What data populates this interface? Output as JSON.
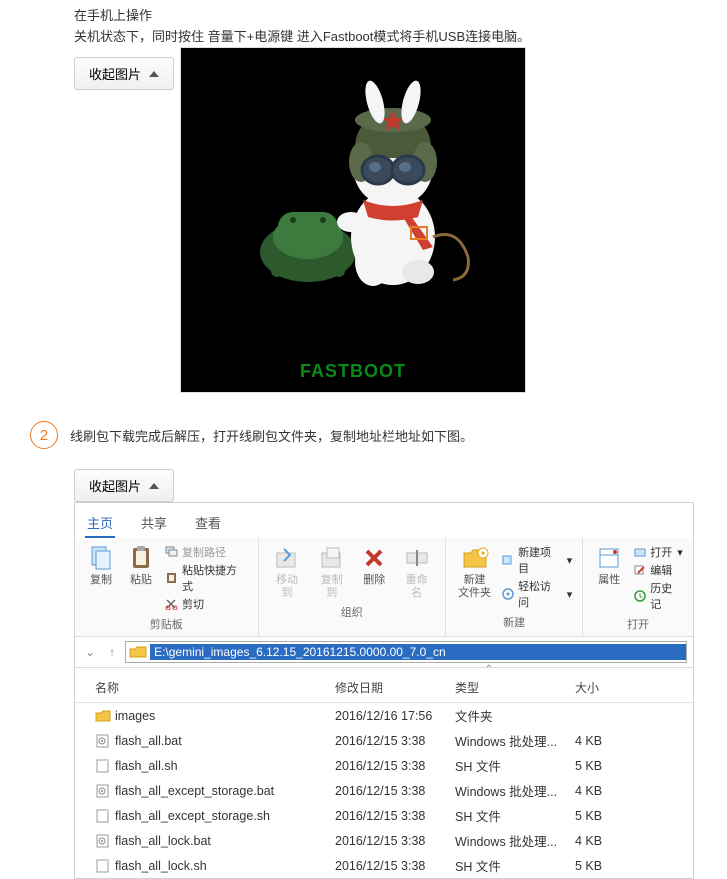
{
  "intro": {
    "line1": "在手机上操作",
    "line2": "关机状态下，同时按住 音量下+电源键 进入Fastboot模式将手机USB连接电脑。"
  },
  "collapse1": "收起图片",
  "fastboot_label": "FASTBOOT",
  "step_num": "2",
  "step_text": "线刷包下载完成后解压，打开线刷包文件夹，复制地址栏地址如下图。",
  "collapse2": "收起图片",
  "explorer": {
    "tabs": {
      "home": "主页",
      "share": "共享",
      "view": "查看"
    },
    "ribbon": {
      "copy": "复制",
      "paste": "粘贴",
      "copy_path": "复制路径",
      "paste_shortcut": "粘贴快捷方式",
      "cut": "剪切",
      "moveto": "移动到",
      "copyto": "复制到",
      "delete": "删除",
      "rename": "重命名",
      "newfolder": "新建\n文件夹",
      "newitem": "新建项目",
      "easyaccess": "轻松访问",
      "properties": "属性",
      "open": "打开",
      "edit": "编辑",
      "history": "历史记",
      "group_clipboard": "剪贴板",
      "group_organize": "组织",
      "group_new": "新建",
      "group_open": "打开"
    },
    "address": "E:\\gemini_images_6.12.15_20161215.0000.00_7.0_cn",
    "columns": {
      "name": "名称",
      "date": "修改日期",
      "type": "类型",
      "size": "大小"
    },
    "files": [
      {
        "icon": "folder",
        "name": "images",
        "date": "2016/12/16 17:56",
        "type": "文件夹",
        "size": ""
      },
      {
        "icon": "bat",
        "name": "flash_all.bat",
        "date": "2016/12/15 3:38",
        "type": "Windows 批处理...",
        "size": "4 KB"
      },
      {
        "icon": "sh",
        "name": "flash_all.sh",
        "date": "2016/12/15 3:38",
        "type": "SH 文件",
        "size": "5 KB"
      },
      {
        "icon": "bat",
        "name": "flash_all_except_storage.bat",
        "date": "2016/12/15 3:38",
        "type": "Windows 批处理...",
        "size": "4 KB"
      },
      {
        "icon": "sh",
        "name": "flash_all_except_storage.sh",
        "date": "2016/12/15 3:38",
        "type": "SH 文件",
        "size": "5 KB"
      },
      {
        "icon": "bat",
        "name": "flash_all_lock.bat",
        "date": "2016/12/15 3:38",
        "type": "Windows 批处理...",
        "size": "4 KB"
      },
      {
        "icon": "sh",
        "name": "flash_all_lock.sh",
        "date": "2016/12/15 3:38",
        "type": "SH 文件",
        "size": "5 KB"
      }
    ]
  }
}
